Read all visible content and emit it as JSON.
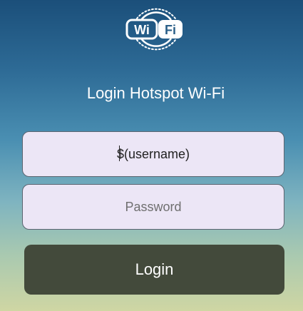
{
  "logo": {
    "icon": "wifi-logo-icon",
    "text_left": "Wi",
    "text_right": "Fi"
  },
  "title": "Login Hotspot Wi-Fi",
  "username": {
    "value": "$(username)",
    "placeholder": ""
  },
  "password": {
    "value": "",
    "placeholder": "Password"
  },
  "login_button": {
    "label": "Login"
  },
  "colors": {
    "gradient_top": "#1b4f7a",
    "gradient_bottom": "#cfd6a3",
    "field_bg": "#ece6f6",
    "button_bg": "#434a3b",
    "text_white": "#ffffff"
  }
}
